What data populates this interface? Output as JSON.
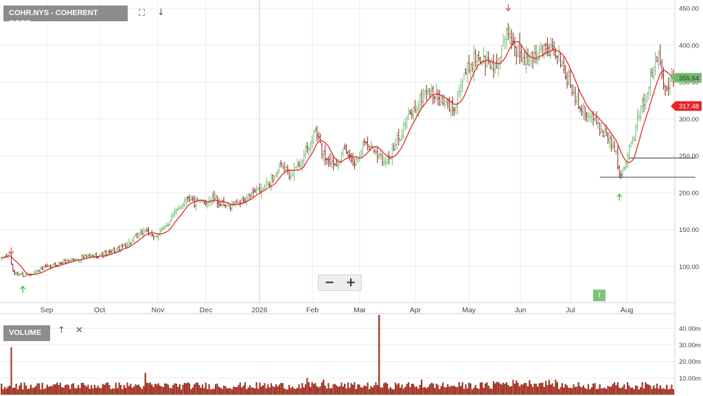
{
  "header": {
    "title_label": "COHR.NYS - COHERENT CORP.",
    "expand_icon": "expand-icon",
    "download_icon": "down-arrow-icon"
  },
  "volume_panel": {
    "label": "VOLUME",
    "up_icon": "up-arrow-icon",
    "close_icon": "close-icon"
  },
  "zoom": {
    "minus_label": "−",
    "plus_label": "+"
  },
  "event_flag": {
    "label": "I"
  },
  "colors": {
    "up_candle": "#6fbf6f",
    "down_candle": "#8a1f1a",
    "ma_line": "#e8232a",
    "volume_bar": "#b5301c",
    "last_price_tag": "#75b96f",
    "ma_tag": "#e8232a",
    "signal_down": "#e85a5a",
    "signal_up": "#2ecc40"
  },
  "chart_data": [
    {
      "type": "candlestick",
      "title": "COHR.NYS - COHERENT CORP.",
      "y_ticks": [
        "100.00",
        "150.00",
        "200.00",
        "250.00",
        "300.00",
        "350.00",
        "400.00",
        "450.00"
      ],
      "ylim": [
        55,
        460
      ],
      "x_tick_labels": [
        "Sep",
        "Oct",
        "Nov",
        "Dec",
        "2026",
        "Feb",
        "Mar",
        "Apr",
        "May",
        "Jun",
        "Jul",
        "Aug"
      ],
      "grid": true,
      "last_price": "355.64",
      "moving_average_value": "317.48",
      "close_anchors": [
        [
          0,
          110
        ],
        [
          5,
          118
        ],
        [
          7,
          92
        ],
        [
          14,
          88
        ],
        [
          20,
          92
        ],
        [
          30,
          100
        ],
        [
          40,
          108
        ],
        [
          50,
          112
        ],
        [
          60,
          115
        ],
        [
          66,
          118
        ],
        [
          74,
          127
        ],
        [
          80,
          135
        ],
        [
          88,
          150
        ],
        [
          92,
          140
        ],
        [
          97,
          145
        ],
        [
          102,
          160
        ],
        [
          108,
          178
        ],
        [
          114,
          196
        ],
        [
          118,
          185
        ],
        [
          124,
          188
        ],
        [
          130,
          192
        ],
        [
          136,
          180
        ],
        [
          142,
          185
        ],
        [
          148,
          190
        ],
        [
          154,
          200
        ],
        [
          160,
          205
        ],
        [
          166,
          220
        ],
        [
          171,
          235
        ],
        [
          176,
          225
        ],
        [
          182,
          240
        ],
        [
          188,
          262
        ],
        [
          192,
          285
        ],
        [
          197,
          250
        ],
        [
          204,
          240
        ],
        [
          210,
          255
        ],
        [
          216,
          240
        ],
        [
          222,
          270
        ],
        [
          228,
          260
        ],
        [
          233,
          245
        ],
        [
          238,
          250
        ],
        [
          243,
          272
        ],
        [
          248,
          300
        ],
        [
          254,
          318
        ],
        [
          260,
          340
        ],
        [
          266,
          330
        ],
        [
          271,
          320
        ],
        [
          276,
          315
        ],
        [
          281,
          345
        ],
        [
          286,
          372
        ],
        [
          291,
          385
        ],
        [
          296,
          378
        ],
        [
          301,
          370
        ],
        [
          306,
          388
        ],
        [
          310,
          418
        ],
        [
          315,
          395
        ],
        [
          320,
          375
        ],
        [
          325,
          385
        ],
        [
          330,
          395
        ],
        [
          335,
          392
        ],
        [
          340,
          388
        ],
        [
          345,
          360
        ],
        [
          350,
          335
        ],
        [
          355,
          315
        ],
        [
          360,
          305
        ],
        [
          365,
          290
        ],
        [
          370,
          278
        ],
        [
          375,
          262
        ],
        [
          378,
          225
        ],
        [
          382,
          245
        ],
        [
          386,
          270
        ],
        [
          390,
          305
        ],
        [
          395,
          338
        ],
        [
          399,
          368
        ],
        [
          402,
          388
        ],
        [
          406,
          345
        ],
        [
          410,
          356
        ]
      ],
      "volume": {
        "y_ticks": [
          "10.00m",
          "20.00m",
          "30.00m",
          "40.00m"
        ],
        "ylim": [
          0,
          48
        ],
        "spikes": [
          [
            6,
            28.5
          ],
          [
            231,
            58
          ],
          [
            88,
            13
          ],
          [
            197,
            9
          ],
          [
            257,
            9
          ],
          [
            187,
            10
          ]
        ]
      },
      "support_levels": [
        247,
        221
      ],
      "signals": [
        {
          "bar": 6,
          "direction": "down"
        },
        {
          "bar": 13,
          "direction": "up"
        },
        {
          "bar": 310,
          "direction": "down"
        },
        {
          "bar": 378,
          "direction": "up"
        }
      ]
    }
  ]
}
